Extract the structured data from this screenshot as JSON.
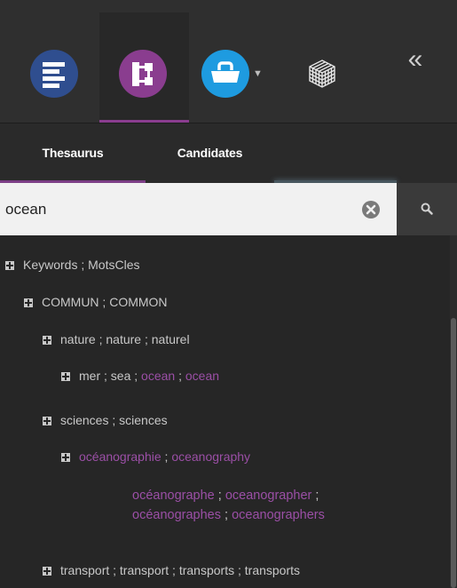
{
  "toolbar": {
    "tools": [
      {
        "name": "list-tool",
        "icon": "list-icon",
        "color": "#2f4e8f"
      },
      {
        "name": "hierarchy-tool",
        "icon": "hierarchy-icon",
        "color": "#8a3d8f"
      },
      {
        "name": "basket-tool",
        "icon": "basket-icon",
        "color": "#1e9be0",
        "has_dropdown": true
      },
      {
        "name": "cube-tool",
        "icon": "cube-icon"
      }
    ],
    "collapse_label": "«"
  },
  "tabs": [
    {
      "label": "Thesaurus",
      "active": true
    },
    {
      "label": "Candidates",
      "active": false
    }
  ],
  "search": {
    "value": "ocean",
    "clear_icon": "clear-icon",
    "button_icon": "search-icon"
  },
  "tree": {
    "nodes": [
      {
        "level": 0,
        "expander": true,
        "segments": [
          {
            "text": "Keywords",
            "hl": false
          },
          {
            "text": "MotsCles",
            "hl": false
          }
        ]
      },
      {
        "level": 1,
        "expander": true,
        "segments": [
          {
            "text": "COMMUN",
            "hl": false
          },
          {
            "text": "COMMON",
            "hl": false
          }
        ]
      },
      {
        "level": 2,
        "expander": true,
        "segments": [
          {
            "text": "nature",
            "hl": false
          },
          {
            "text": "nature",
            "hl": false
          },
          {
            "text": "naturel",
            "hl": false
          }
        ]
      },
      {
        "level": 3,
        "expander": true,
        "segments": [
          {
            "text": "mer",
            "hl": false
          },
          {
            "text": "sea",
            "hl": false
          },
          {
            "text": "ocean",
            "hl": true
          },
          {
            "text": "ocean",
            "hl": true
          }
        ]
      },
      {
        "level": 2,
        "expander": true,
        "segments": [
          {
            "text": "sciences",
            "hl": false
          },
          {
            "text": "sciences",
            "hl": false
          }
        ]
      },
      {
        "level": 3,
        "expander": true,
        "segments": [
          {
            "text": "océanographie",
            "hl": true
          },
          {
            "text": "oceanography",
            "hl": true
          }
        ]
      },
      {
        "level": 4,
        "expander": false,
        "segments": [
          {
            "text": "océanographe",
            "hl": true
          },
          {
            "text": "oceanographer",
            "hl": true
          },
          {
            "text": "océanographes",
            "hl": true
          },
          {
            "text": "oceanographers",
            "hl": true
          }
        ]
      },
      {
        "level": 2,
        "expander": true,
        "segments": [
          {
            "text": "transport",
            "hl": false
          },
          {
            "text": "transport",
            "hl": false
          },
          {
            "text": "transports",
            "hl": false
          },
          {
            "text": "transports",
            "hl": false
          }
        ]
      }
    ]
  }
}
